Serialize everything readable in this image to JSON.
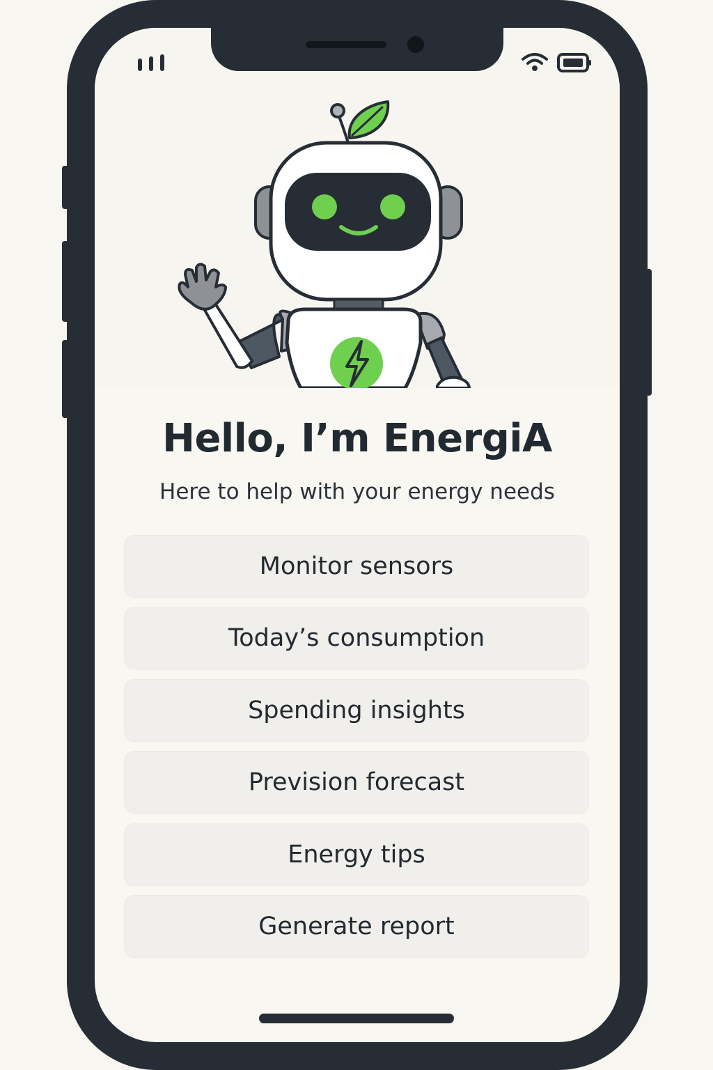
{
  "app": {
    "title": "Hello, I’m EnergiA",
    "subtitle": "Here to help with your energy needs"
  },
  "status_bar": {
    "signal_icon": "signal-bars-icon",
    "wifi_icon": "wifi-icon",
    "battery_icon": "battery-icon"
  },
  "mascot": {
    "name": "robot-mascot",
    "chest_icon": "lightning-bolt-icon",
    "antenna_icon": "leaf-icon"
  },
  "menu": {
    "items": [
      {
        "label": "Monitor sensors"
      },
      {
        "label": "Today’s consumption"
      },
      {
        "label": "Spending insights"
      },
      {
        "label": "Prevision forecast"
      },
      {
        "label": "Energy tips"
      },
      {
        "label": "Generate report"
      }
    ]
  },
  "colors": {
    "accent": "#6fcf4f",
    "frame": "#262d35",
    "background": "#f9f7f2",
    "button_bg": "#f1efeb",
    "text": "#222a31"
  }
}
